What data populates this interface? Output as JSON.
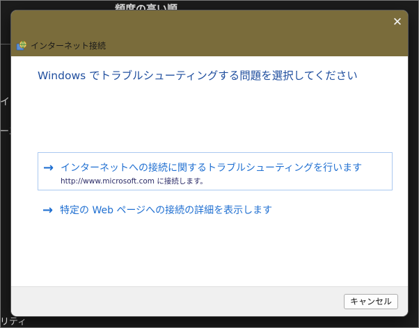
{
  "background": {
    "heading": "頻度の高い順",
    "side_text_1": "イス",
    "side_text_2": "ース",
    "side_text_3": "リティ"
  },
  "dialog": {
    "close_glyph": "✕",
    "title": "インターネット接続",
    "app_icon": "globe-network-icon",
    "heading": "Windows でトラブルシューティングする問題を選択してください",
    "options": [
      {
        "arrow": "→",
        "title": "インターネットへの接続に関するトラブルシューティングを行います",
        "description": "http://www.microsoft.com に接続します。"
      },
      {
        "arrow": "→",
        "title": "特定の Web ページへの接続の詳細を表示します"
      }
    ],
    "cancel_label": "キャンセル"
  },
  "colors": {
    "title_bar": "#7a6c3b",
    "heading_text": "#1f4e9e",
    "link_text": "#1f6fd1",
    "option_border": "#a9c8f0",
    "footer_bg": "#f0f0f0"
  }
}
